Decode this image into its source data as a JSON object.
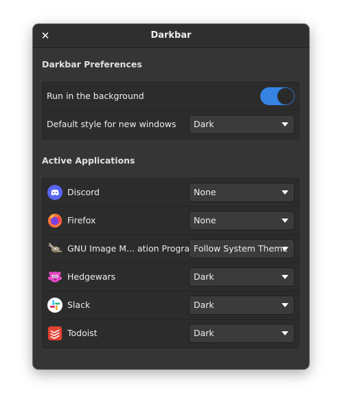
{
  "window": {
    "title": "Darkbar",
    "close_icon": "close-icon"
  },
  "preferences": {
    "title": "Darkbar Preferences",
    "run_in_background": {
      "label": "Run in the background",
      "enabled": true
    },
    "default_style": {
      "label": "Default style for new windows",
      "value": "Dark"
    }
  },
  "applications": {
    "title": "Active Applications",
    "items": [
      {
        "name": "Discord",
        "icon": "discord-icon",
        "value": "None"
      },
      {
        "name": "Firefox",
        "icon": "firefox-icon",
        "value": "None"
      },
      {
        "name": "GNU Image M... ation Program",
        "icon": "gimp-icon",
        "value": "Follow System Theme"
      },
      {
        "name": "Hedgewars",
        "icon": "hedgewars-icon",
        "value": "Dark"
      },
      {
        "name": "Slack",
        "icon": "slack-icon",
        "value": "Dark"
      },
      {
        "name": "Todoist",
        "icon": "todoist-icon",
        "value": "Dark"
      }
    ]
  },
  "colors": {
    "accent": "#3584e4",
    "window_bg": "#353535",
    "list_bg": "#2c2c2c"
  }
}
